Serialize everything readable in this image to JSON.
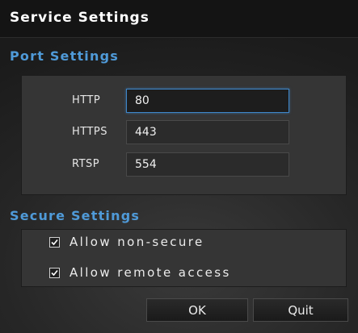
{
  "dialog": {
    "title": "Service Settings"
  },
  "port_settings": {
    "title": "Port Settings",
    "rows": [
      {
        "label": "HTTP",
        "value": "80",
        "focused": true
      },
      {
        "label": "HTTPS",
        "value": "443",
        "focused": false
      },
      {
        "label": "RTSP",
        "value": "554",
        "focused": false
      }
    ]
  },
  "secure_settings": {
    "title": "Secure Settings",
    "options": [
      {
        "label": "Allow non-secure",
        "checked": true
      },
      {
        "label": "Allow remote access",
        "checked": true
      }
    ]
  },
  "buttons": {
    "ok_label": "OK",
    "quit_label": "Quit"
  },
  "colors": {
    "accent": "#4f9ad8",
    "focus_border": "#3f86c9"
  },
  "icons": {
    "checkbox": "checkmark-icon"
  }
}
